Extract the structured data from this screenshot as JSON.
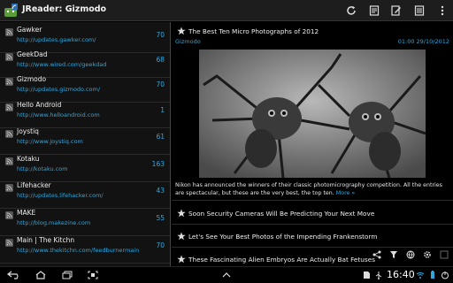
{
  "app": {
    "title": "JReader: Gizmodo"
  },
  "action_icons": [
    "refresh-icon",
    "mark-read-icon",
    "compose-icon",
    "edit-list-icon",
    "overflow-menu-icon"
  ],
  "feeds": [
    {
      "title": "Gawker",
      "url": "http://updates.gawker.com/",
      "count": "70"
    },
    {
      "title": "GeekDad",
      "url": "http://www.wired.com/geekdad",
      "count": "68"
    },
    {
      "title": "Gizmodo",
      "url": "http://updates.gizmodo.com/",
      "count": "70"
    },
    {
      "title": "Hello Android",
      "url": "http://www.helloandroid.com",
      "count": "1"
    },
    {
      "title": "Joystiq",
      "url": "http://www.joystiq.com",
      "count": "61"
    },
    {
      "title": "Kotaku",
      "url": "http://kotaku.com",
      "count": "163"
    },
    {
      "title": "Lifehacker",
      "url": "http://updates.lifehacker.com/",
      "count": "43"
    },
    {
      "title": "MAKE",
      "url": "http://blog.makezine.com",
      "count": "55"
    },
    {
      "title": "Main | The Kitchn",
      "url": "http://www.thekitchn.com/feedburnermain",
      "count": "70"
    }
  ],
  "article": {
    "title": "The Best Ten Micro Photographs of 2012",
    "source": "Gizmodo",
    "date": "01:00 29/10/2012",
    "summary": "Nikon has announced the winners of their classic photomicrography competition. All the entries are spectacular, but these are the very best, the top ten.",
    "more": "More »"
  },
  "other_articles": [
    {
      "title": "Soon Security Cameras Will Be Predicting Your Next Move"
    },
    {
      "title": "Let's See Your Best Photos of the Impending Frankenstorm"
    },
    {
      "title": "These Fascinating Alien Embryos Are Actually Bat Fetuses"
    }
  ],
  "system_bar": {
    "time": "16:40"
  },
  "colors": {
    "accent": "#2fa7dd",
    "background": "#000000",
    "sidebar": "#121212"
  }
}
